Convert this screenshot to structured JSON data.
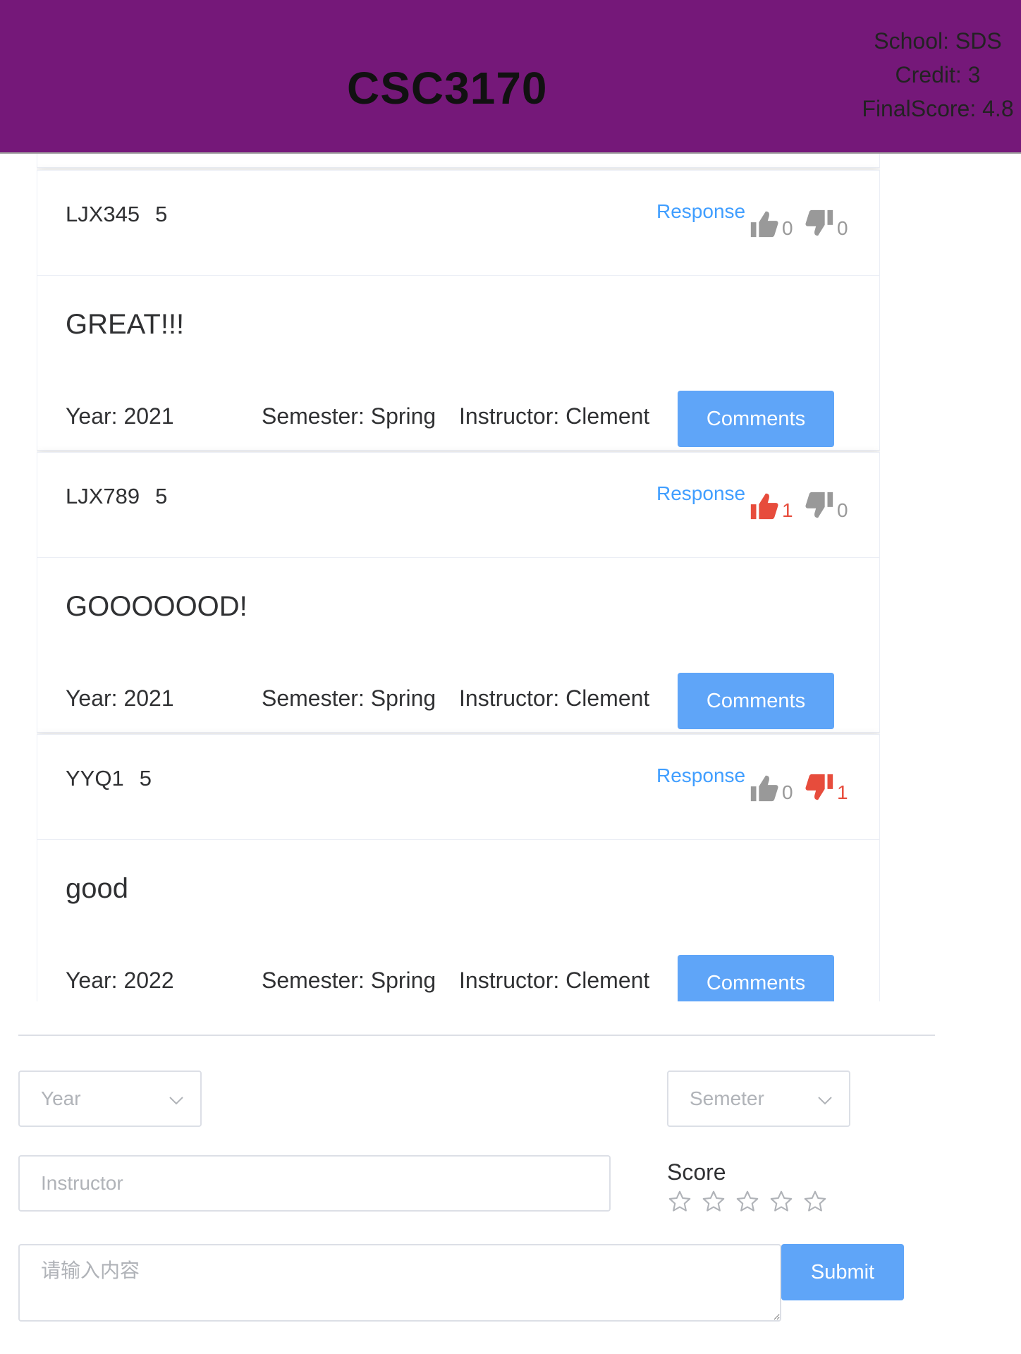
{
  "header": {
    "course_code": "CSC3170",
    "school": "School: SDS",
    "credit": "Credit: 3",
    "final_score": "FinalScore: 4.8"
  },
  "comments": [
    {
      "user": "LJX345",
      "score": "5",
      "response_label": "Response",
      "likes": "0",
      "likes_active": false,
      "dislikes": "0",
      "dislikes_active": false,
      "content": "GREAT!!!",
      "year": "Year: 2021",
      "semester": "Semester: Spring",
      "instructor": "Instructor: Clement",
      "comments_label": "Comments"
    },
    {
      "user": "LJX789",
      "score": "5",
      "response_label": "Response",
      "likes": "1",
      "likes_active": true,
      "dislikes": "0",
      "dislikes_active": false,
      "content": "GOOOOOOD!",
      "year": "Year: 2021",
      "semester": "Semester: Spring",
      "instructor": "Instructor: Clement",
      "comments_label": "Comments"
    },
    {
      "user": "YYQ1",
      "score": "5",
      "response_label": "Response",
      "likes": "0",
      "likes_active": false,
      "dislikes": "1",
      "dislikes_active": true,
      "content": "good",
      "year": "Year: 2022",
      "semester": "Semester: Spring",
      "instructor": "Instructor: Clement",
      "comments_label": "Comments"
    }
  ],
  "form": {
    "year_placeholder": "Year",
    "semester_placeholder": "Semeter",
    "instructor_placeholder": "Instructor",
    "score_label": "Score",
    "stars": 5,
    "rating": 0,
    "content_placeholder": "请输入内容",
    "submit_label": "Submit"
  },
  "colors": {
    "header": "#751879",
    "accent": "#409eff",
    "button": "#5fa5f8",
    "active_vote": "#e74c3c",
    "inactive_vote": "#999999"
  },
  "icons": [
    "thumbs-up-icon",
    "thumbs-down-icon",
    "chevron-down-icon",
    "star-outline-icon"
  ]
}
